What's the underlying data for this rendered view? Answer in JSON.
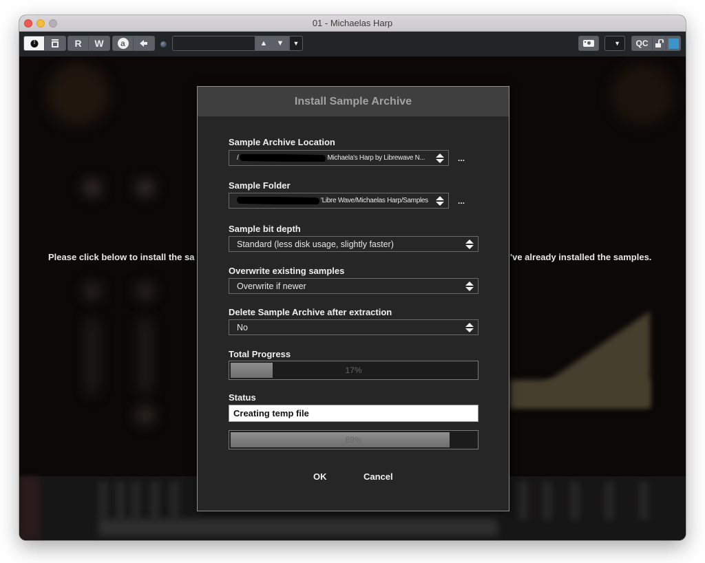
{
  "window": {
    "title": "01 - Michaelas Harp"
  },
  "toolbar": {
    "power_icon": "power-icon",
    "insert_icon": "insert-slot-icon",
    "read_label": "R",
    "write_label": "W",
    "auto_label": "a",
    "arrow_icon": "left-arrow-icon",
    "preset_value": "",
    "qc_label": "QC",
    "highlight_color": "#3b95c8"
  },
  "background": {
    "message_left": "Please click below to install the sa",
    "message_right": "'ve already installed the samples."
  },
  "dialog": {
    "title": "Install Sample Archive",
    "archive_location": {
      "label": "Sample Archive Location",
      "prefix": "/",
      "value": "Michaela's Harp by Librewave N..."
    },
    "sample_folder": {
      "label": "Sample Folder",
      "value": "'Libre Wave/Michaelas Harp/Samples"
    },
    "browse_label": "...",
    "bit_depth": {
      "label": "Sample bit depth",
      "value": "Standard (less disk usage, slightly faster)"
    },
    "overwrite": {
      "label": "Overwrite existing samples",
      "value": "Overwrite if newer"
    },
    "delete_archive": {
      "label": "Delete Sample Archive after extraction",
      "value": "No"
    },
    "total_progress": {
      "label": "Total Progress",
      "percent": 17,
      "text": "17%"
    },
    "status": {
      "label": "Status",
      "value": "Creating temp file"
    },
    "file_progress": {
      "percent": 89,
      "text": "89%"
    },
    "ok_label": "OK",
    "cancel_label": "Cancel"
  }
}
